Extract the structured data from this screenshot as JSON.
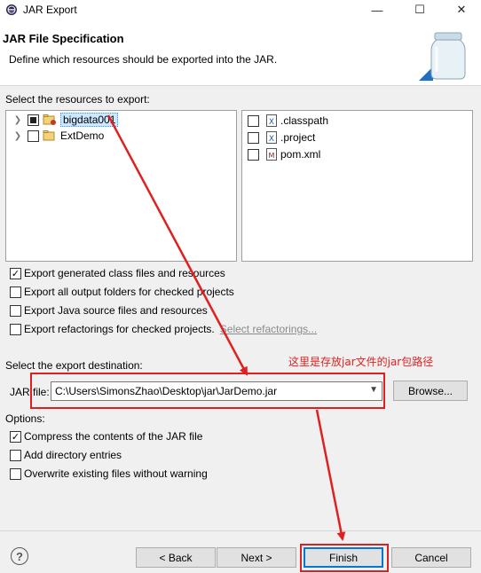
{
  "window": {
    "title": "JAR Export",
    "minimize": "—",
    "maximize": "☐",
    "close": "✕"
  },
  "header": {
    "title": "JAR File Specification",
    "description": "Define which resources should be exported into the JAR."
  },
  "resources_label": "Select the resources to export:",
  "tree": [
    {
      "label": "bigdata001",
      "state": "partial",
      "selected": true
    },
    {
      "label": "ExtDemo",
      "state": "unchecked",
      "selected": false
    }
  ],
  "files": [
    {
      "label": ".classpath",
      "icon": "xml-file-icon"
    },
    {
      "label": ".project",
      "icon": "xml-file-icon"
    },
    {
      "label": "pom.xml",
      "icon": "maven-pom-icon"
    }
  ],
  "options_top": [
    {
      "label": "Export generated class files and resources",
      "checked": true
    },
    {
      "label": "Export all output folders for checked projects",
      "checked": false
    },
    {
      "label": "Export Java source files and resources",
      "checked": false
    },
    {
      "label": "Export refactorings for checked projects.",
      "checked": false
    }
  ],
  "select_refactorings_link": "Select refactorings...",
  "destination_label": "Select the export destination:",
  "annotation": "这里是存放jar文件的jar包路径",
  "jar_file_label": "JAR file:",
  "jar_file_value": "C:\\Users\\SimonsZhao\\Desktop\\jar\\JarDemo.jar",
  "browse_button": "Browse...",
  "options_label": "Options:",
  "options_bottom": [
    {
      "label": "Compress the contents of the JAR file",
      "checked": true
    },
    {
      "label": "Add directory entries",
      "checked": false
    },
    {
      "label": "Overwrite existing files without warning",
      "checked": false
    }
  ],
  "buttons": {
    "back": "< Back",
    "next": "Next >",
    "finish": "Finish",
    "cancel": "Cancel"
  },
  "help_glyph": "?",
  "colors": {
    "annotation_red": "#e02020",
    "selection": "#cce8ff",
    "default_button_border": "#0078d7"
  }
}
